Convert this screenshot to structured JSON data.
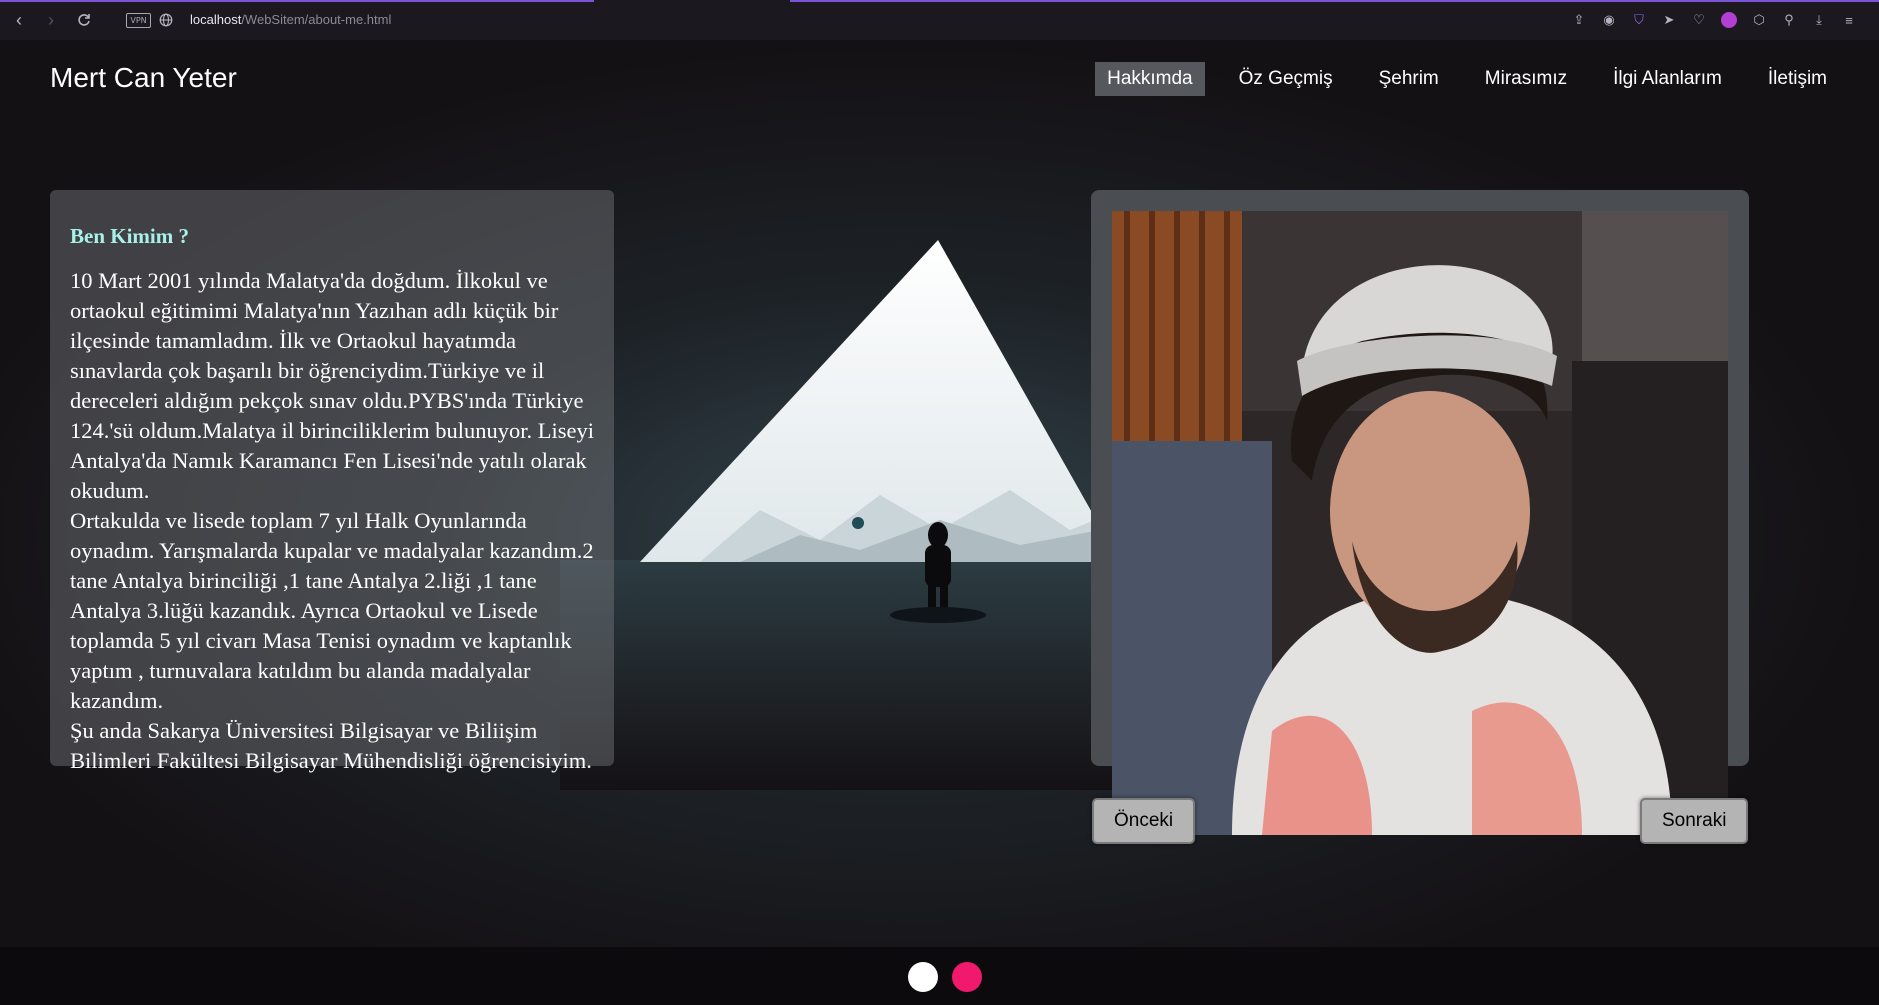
{
  "browser": {
    "url_host": "localhost",
    "url_path": "/WebSitem/about-me.html",
    "vpn_label": "VPN"
  },
  "site": {
    "title": "Mert Can Yeter"
  },
  "nav": {
    "items": [
      {
        "label": "Hakkımda",
        "active": true
      },
      {
        "label": "Öz Geçmiş"
      },
      {
        "label": "Şehrim"
      },
      {
        "label": "Mirasımız"
      },
      {
        "label": "İlgi Alanlarım"
      },
      {
        "label": "İletişim"
      }
    ]
  },
  "about": {
    "heading": "Ben Kimim ?",
    "text": "10 Mart 2001 yılında Malatya'da doğdum. İlkokul ve ortaokul eğitimimi Malatya'nın Yazıhan adlı küçük bir ilçesinde tamamladım. İlk ve Ortaokul hayatımda sınavlarda çok başarılı bir öğrenciydim.Türkiye ve il dereceleri aldığım pekçok sınav oldu.PYBS'ında Türkiye 124.'sü oldum.Malatya il birinciliklerim bulunuyor. Liseyi Antalya'da Namık Karamancı Fen Lisesi'nde yatılı olarak okudum.\nOrtakulda ve lisede toplam 7 yıl Halk Oyunlarında oynadım. Yarışmalarda kupalar ve madalyalar kazandım.2 tane Antalya birinciliği ,1 tane Antalya 2.liği ,1 tane Antalya 3.lüğü kazandık. Ayrıca Ortaokul ve Lisede toplamda 5 yıl civarı Masa Tenisi oynadım ve kaptanlık yaptım , turnuvalara katıldım bu alanda madalyalar kazandım.\nŞu anda Sakarya Üniversitesi Bilgisayar ve Biliişim Bilimleri Fakültesi Bilgisayar Mühendisliği öğrencisiyim."
  },
  "gallery": {
    "prev_label": "Önceki",
    "next_label": "Sonraki"
  },
  "colors": {
    "accent_dot_1": "#ffffff",
    "accent_dot_2": "#f0196e",
    "heading_color": "#a8f0ea"
  }
}
